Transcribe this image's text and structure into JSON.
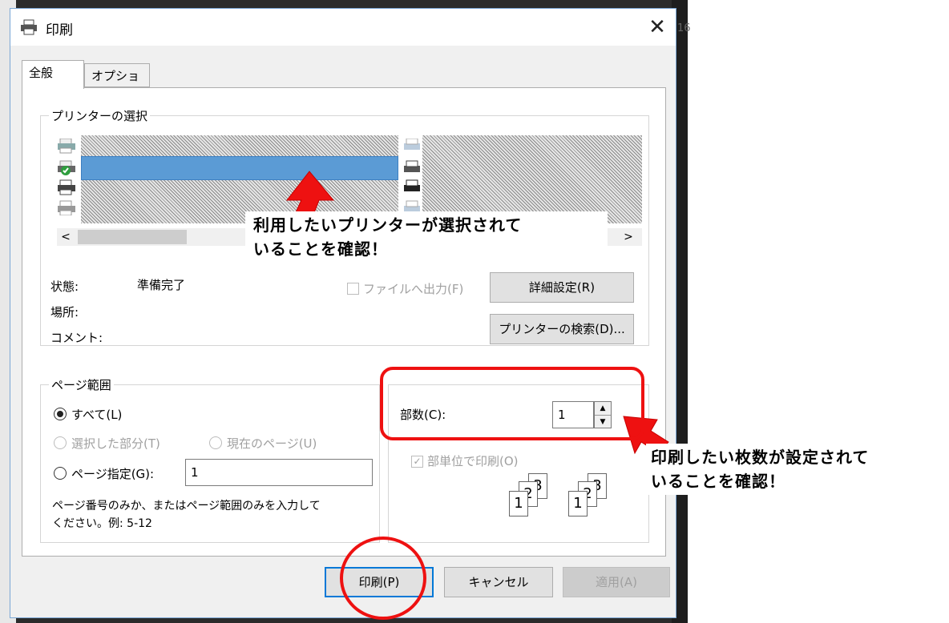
{
  "window": {
    "title": "印刷",
    "close_glyph": "✕"
  },
  "background": {
    "peek_text": "16"
  },
  "tabs": [
    {
      "label": "全般"
    },
    {
      "label": "オプション"
    }
  ],
  "printer_select": {
    "group_label": "プリンターの選択"
  },
  "status": {
    "status_label": "状態:",
    "status_value": "準備完了",
    "location_label": "場所:",
    "comment_label": "コメント:"
  },
  "print_to_file": {
    "label": "ファイルへ出力(F)",
    "checked": false
  },
  "buttons": {
    "preferences": "詳細設定(R)",
    "find_printer": "プリンターの検索(D)...",
    "print": "印刷(P)",
    "cancel": "キャンセル",
    "apply": "適用(A)"
  },
  "page_range": {
    "group_label": "ページ範囲",
    "all": "すべて(L)",
    "selection": "選択した部分(T)",
    "current_page": "現在のページ(U)",
    "pages": "ページ指定(G):",
    "pages_value": "1",
    "hint_line1": "ページ番号のみか、またはページ範囲のみを入力して",
    "hint_line2": "ください。例: 5-12"
  },
  "copies": {
    "label": "部数(C):",
    "value": "1",
    "collate": "部単位で印刷(O)",
    "collate_checked": true,
    "collate_digits": [
      "1",
      "2",
      "3"
    ]
  },
  "annotations": {
    "printer_note_line1": "利用したいプリンターが選択されて",
    "printer_note_line2": "いることを確認！",
    "copies_note_line1": "印刷したい枚数が設定されて",
    "copies_note_line2": "いることを確認！"
  },
  "colors": {
    "annotation_red": "#ee1111",
    "selection_blue": "#5b9bd5",
    "dialog_bg": "#f0f0f0"
  }
}
